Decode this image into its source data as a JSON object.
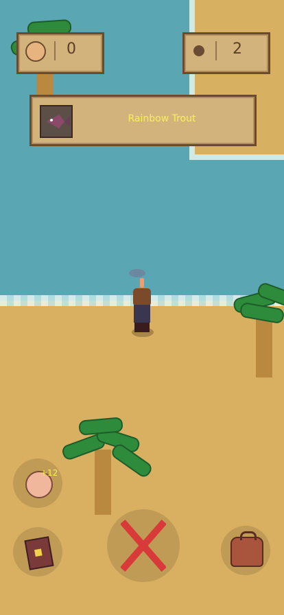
{
  "hud": {
    "food_count": "0",
    "coin_count": "2"
  },
  "catch": {
    "fish_name": "Rainbow Trout"
  },
  "actions": {
    "cookie_bonus": "+12"
  },
  "colors": {
    "water": "#5aa6b3",
    "sand": "#d9b061",
    "panel": "#d3b37c",
    "panel_border": "#6b4b2d",
    "fish_text": "#f7f05a",
    "cancel_x": "#d83a3a"
  }
}
